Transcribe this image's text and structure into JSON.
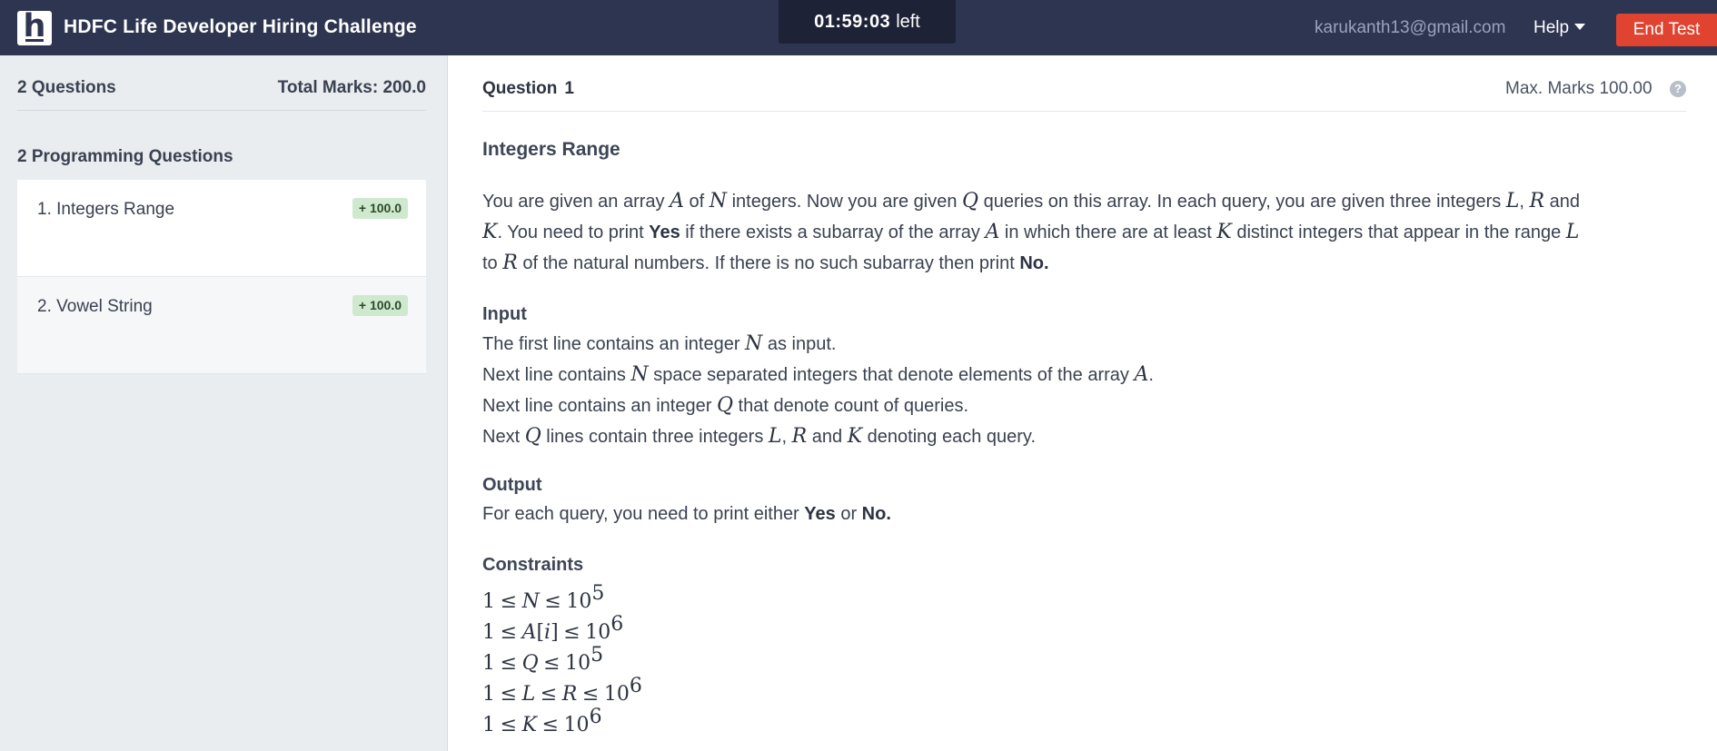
{
  "header": {
    "logo_letter": "h",
    "title": "HDFC Life Developer Hiring Challenge",
    "timer": {
      "time": "01:59:03",
      "suffix": "left"
    },
    "email": "karukanth13@gmail.com",
    "help_label": "Help",
    "end_test_label": "End Test"
  },
  "sidebar": {
    "question_count": "2 Questions",
    "total_marks": "Total Marks: 200.0",
    "section_title": "2 Programming Questions",
    "questions": [
      {
        "label": "1. Integers Range",
        "badge": "+ 100.0",
        "active": true
      },
      {
        "label": "2. Vowel String",
        "badge": "+ 100.0",
        "active": false
      }
    ]
  },
  "question": {
    "label": "Question",
    "number": "1",
    "max_marks": "Max. Marks 100.00",
    "help_icon": "?",
    "title": "Integers Range",
    "statement": {
      "l1a": "You are given an array ",
      "l1b": " of ",
      "l1c": " integers. Now you are given ",
      "l1d": " queries on this array. In each query, you are given three integers ",
      "l1e": ", ",
      "l1f": " and",
      "l2a": ". You need to print ",
      "l2b": "Yes",
      "l2c": " if there exists a subarray of the array ",
      "l2d": " in which there are at least ",
      "l2e": " distinct integers that appear in the range ",
      "l3a": "to ",
      "l3b": " of the natural numbers. If there is no such subarray then print ",
      "l3c": "No."
    },
    "vars": {
      "A": "A",
      "N": "N",
      "Q": "Q",
      "L": "L",
      "R": "R",
      "K": "K"
    },
    "input_heading": "Input",
    "input": {
      "i1a": "The first line contains an integer ",
      "i1b": " as input.",
      "i2a": "Next line contains ",
      "i2b": " space separated integers that denote elements of the array ",
      "i2c": ".",
      "i3a": "Next line contains an integer ",
      "i3b": " that denote count of queries.",
      "i4a": "Next ",
      "i4b": " lines contain three integers ",
      "i4c": ", ",
      "i4d": " and ",
      "i4e": " denoting each query."
    },
    "output_heading": "Output",
    "output": {
      "o1a": "For each query, you need to print either ",
      "o1b": "Yes",
      "o1c": " or ",
      "o1d": "No."
    },
    "constraints_heading": "Constraints",
    "math": {
      "one": "1",
      "le": "≤",
      "ten": "10",
      "e5": "5",
      "e6": "6",
      "Ai": "A",
      "i": "i",
      "lb": "[",
      "rb": "]"
    }
  }
}
